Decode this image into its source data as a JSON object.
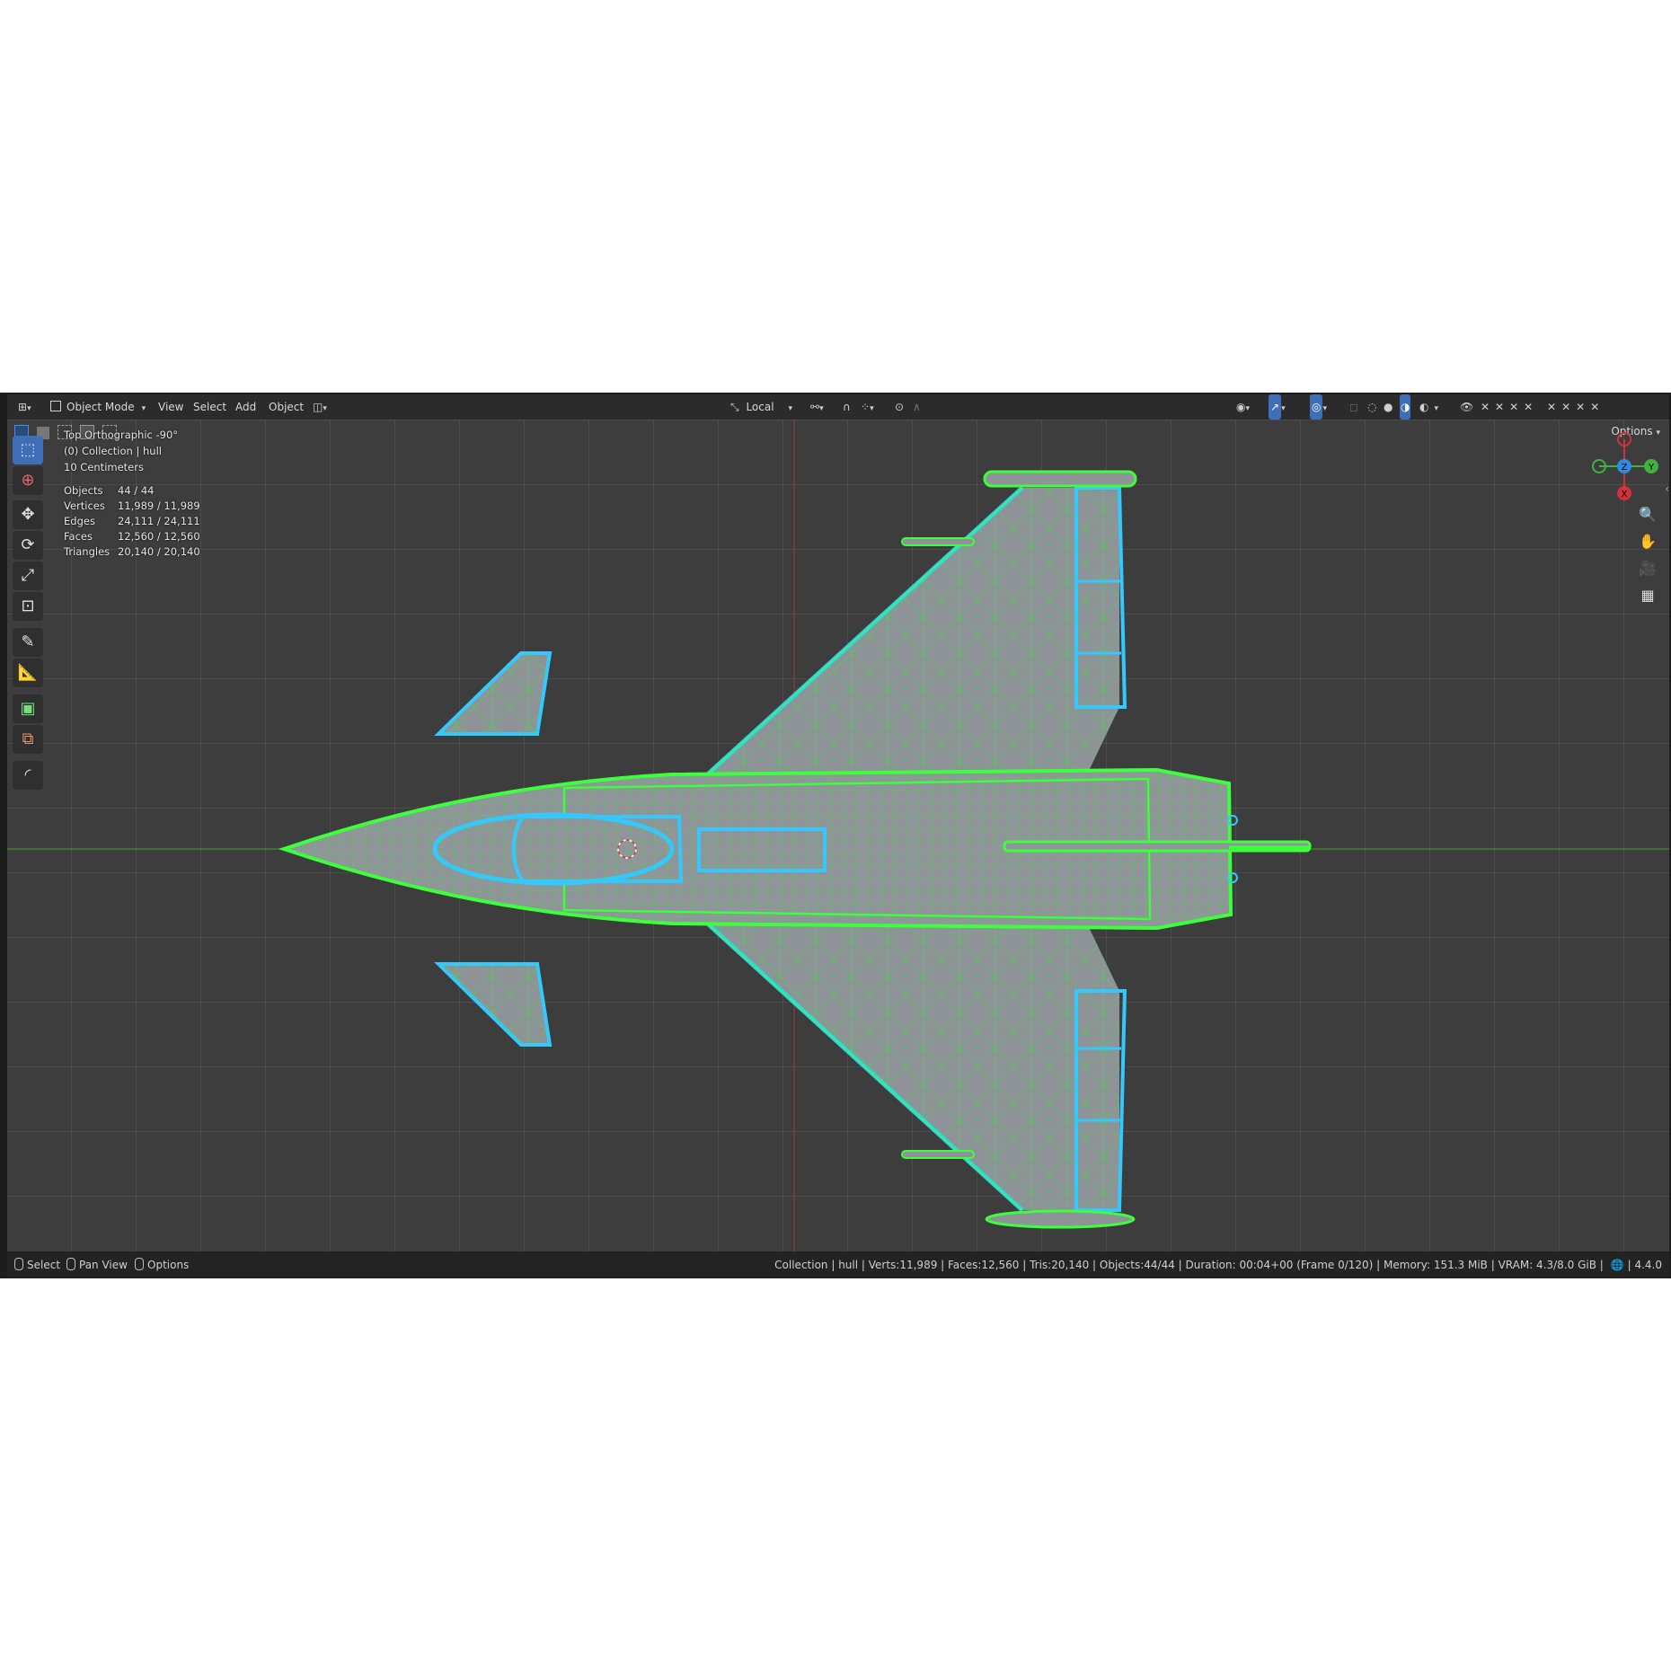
{
  "header": {
    "mode_label": "Object Mode",
    "menu": [
      "View",
      "Select",
      "Add",
      "Object"
    ],
    "transform_orientation": "Local",
    "options_label": "Options"
  },
  "viewport": {
    "view_name": "Top Orthographic -90°",
    "collection_line": "(0) Collection | hull",
    "scale_line": "10 Centimeters",
    "stats": [
      {
        "label": "Objects",
        "value": "44 / 44"
      },
      {
        "label": "Vertices",
        "value": "11,989 / 11,989"
      },
      {
        "label": "Edges",
        "value": "24,111 / 24,111"
      },
      {
        "label": "Faces",
        "value": "12,560 / 12,560"
      },
      {
        "label": "Triangles",
        "value": "20,140 / 20,140"
      }
    ],
    "gizmo_axes": {
      "x": "X",
      "y": "Y",
      "z": "Z"
    },
    "colors": {
      "background": "#3d3d3d",
      "wire_selected": "#3dff3d",
      "wire_active": "#33c9ff",
      "mesh_surface": "#8e9496",
      "x_axis": "#d2303a",
      "y_axis": "#3fb23f",
      "z_axis": "#2d8ce0"
    }
  },
  "toolbar": {
    "tools": [
      "select-box-icon",
      "cursor-icon",
      "move-icon",
      "rotate-icon",
      "scale-icon",
      "transform-icon",
      "annotate-icon",
      "measure-icon",
      "add-cube-icon",
      "transform-pivot-icon",
      "bend-icon"
    ]
  },
  "statusbar": {
    "hints": [
      "Select",
      "Pan View",
      "Options"
    ],
    "info": "Collection | hull | Verts:11,989 | Faces:12,560 | Tris:20,140 | Objects:44/44 | Duration: 00:04+00 (Frame 0/120) | Memory: 151.3 MiB | VRAM: 4.3/8.0 GiB |",
    "version": "4.4.0"
  }
}
